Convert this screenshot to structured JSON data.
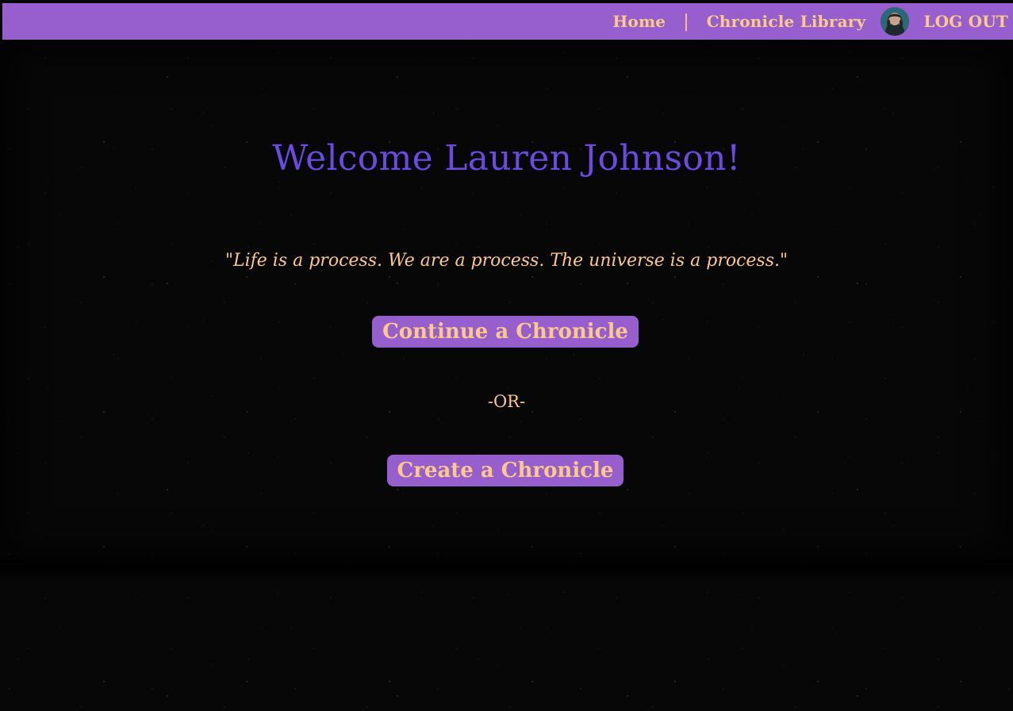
{
  "nav": {
    "home_label": "Home",
    "separator": "|",
    "library_label": "Chronicle Library",
    "logout_label": "LOG OUT"
  },
  "main": {
    "welcome": "Welcome Lauren Johnson!",
    "quote": "\"Life is a process. We are a process. The universe is a process.\"",
    "continue_label": "Continue a Chronicle",
    "or_text": "-OR-",
    "create_label": "Create a Chronicle"
  },
  "colors": {
    "navbar": "#965fcd",
    "accent_text": "#fcc98a",
    "heading": "#6a4ae3",
    "background": "#050505"
  },
  "icons": {
    "avatar": "user-avatar-photo"
  }
}
